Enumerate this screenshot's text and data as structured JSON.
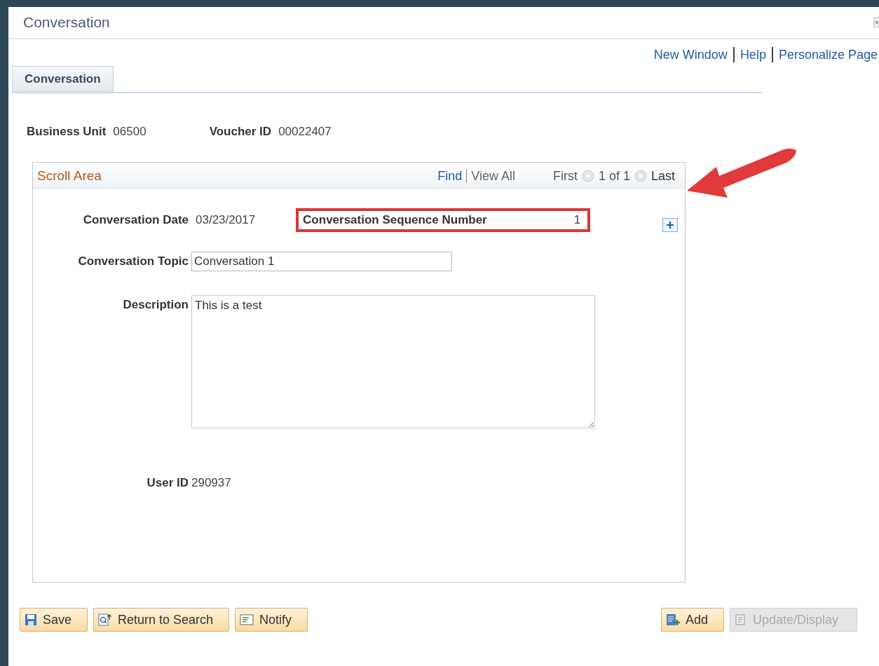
{
  "window": {
    "title": "Conversation"
  },
  "top_links": [
    "New Window",
    "Help",
    "Personalize Page"
  ],
  "tabs": [
    {
      "label": "Conversation",
      "selected": true
    }
  ],
  "header_fields": [
    {
      "label": "Business Unit",
      "value": "06500"
    },
    {
      "label": "Voucher ID",
      "value": "00022407"
    }
  ],
  "scroll_area": {
    "title": "Scroll Area",
    "find": "Find",
    "view_all": "View All",
    "first": "First",
    "count": "1 of 1",
    "last": "Last",
    "date_label": "Conversation Date",
    "date_value": "03/23/2017",
    "sequence_label": "Conversation Sequence Number",
    "sequence_value": "1",
    "sequence_highlighted": true,
    "topic_label": "Conversation Topic",
    "topic_value": "Conversation 1",
    "description_label": "Description",
    "description_value": "This is a test",
    "user_label": "User ID",
    "user_value": "290937"
  },
  "buttons": [
    {
      "label": "Save",
      "kind": "save",
      "disabled": false
    },
    {
      "label": "Return to Search",
      "kind": "search",
      "disabled": false
    },
    {
      "label": "Notify",
      "kind": "notify",
      "disabled": false
    },
    {
      "label": "Add",
      "kind": "add",
      "disabled": false
    },
    {
      "label": "Update/Display",
      "kind": "update",
      "disabled": true
    }
  ]
}
